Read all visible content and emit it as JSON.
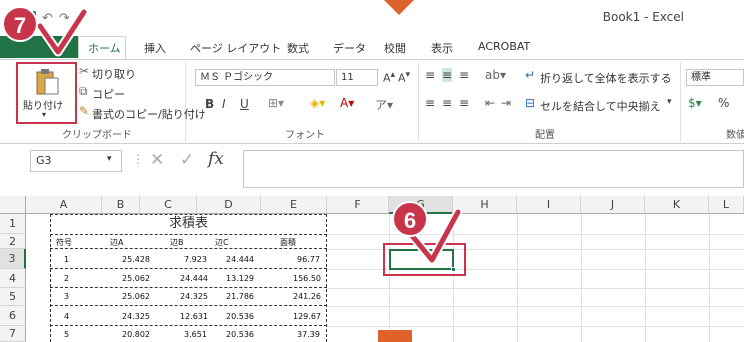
{
  "window": {
    "title": "Book1 - Excel"
  },
  "qat": {
    "save_icon": "save-icon",
    "undo_glyph": "↶",
    "redo_glyph": "↷",
    "customize_glyph": "≡"
  },
  "tabs": [
    {
      "label": "ホーム"
    },
    {
      "label": "挿入"
    },
    {
      "label": "ページ レイアウト"
    },
    {
      "label": "数式"
    },
    {
      "label": "データ"
    },
    {
      "label": "校閲"
    },
    {
      "label": "表示"
    },
    {
      "label": "ACROBAT"
    }
  ],
  "clipboard": {
    "paste_label": "貼り付け",
    "cut_label": "切り取り",
    "copy_label": "コピー",
    "format_painter_label": "書式のコピー/貼り付け",
    "group_label": "クリップボード"
  },
  "font": {
    "name": "ＭＳ Ｐゴシック",
    "size": "11",
    "group_label": "フォント",
    "bold": "B",
    "italic": "I",
    "underline": "U"
  },
  "alignment": {
    "wrap_label": "折り返して全体を表示する",
    "merge_label": "セルを結合して中央揃え",
    "group_label": "配置"
  },
  "number": {
    "format_value": "標準",
    "percent": "%",
    "group_label": "数値"
  },
  "formula_bar": {
    "name_box": "G3",
    "fx": "fx",
    "value": ""
  },
  "columns": [
    "A",
    "B",
    "C",
    "D",
    "E",
    "F",
    "G",
    "H",
    "I",
    "J",
    "K",
    "L"
  ],
  "rows": [
    "1",
    "2",
    "3",
    "4",
    "5",
    "6",
    "7"
  ],
  "table": {
    "title": "求積表",
    "headers": [
      "符号",
      "辺A",
      "辺B",
      "辺C",
      "面積"
    ],
    "rows": [
      [
        "1",
        "25.428",
        "7.923",
        "24.444",
        "96.77"
      ],
      [
        "2",
        "25.062",
        "24.444",
        "13.129",
        "156.50"
      ],
      [
        "3",
        "25.062",
        "24.325",
        "21.786",
        "241.26"
      ],
      [
        "4",
        "24.325",
        "12.631",
        "20.536",
        "129.67"
      ],
      [
        "5",
        "20.802",
        "3.651",
        "20.536",
        "37.39"
      ]
    ]
  },
  "steps": {
    "step6": "6",
    "step7": "7"
  },
  "colors": {
    "accent": "#217346",
    "annotation": "#c8354a",
    "arrow": "#e0622a"
  }
}
